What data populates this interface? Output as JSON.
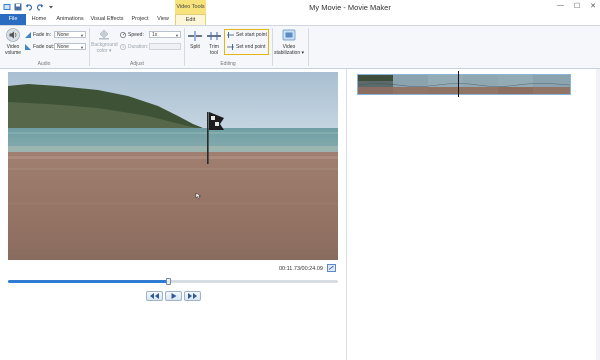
{
  "window": {
    "title": "My Movie - Movie Maker",
    "context_tab": "Video Tools",
    "controls": [
      "—",
      "☐",
      "✕"
    ]
  },
  "quick_access": {
    "icons": [
      "movie-maker-app-icon",
      "save-icon",
      "undo-icon",
      "redo-icon",
      "dropdown-icon"
    ]
  },
  "tabs": [
    "File",
    "Home",
    "Animations",
    "Visual Effects",
    "Project",
    "View",
    "Edit"
  ],
  "ribbon": {
    "audio": {
      "label": "Audio",
      "video_volume_line1": "Video",
      "video_volume_line2": "volume",
      "fade_in_label": "Fade in:",
      "fade_in_value": "None",
      "fade_out_label": "Fade out:",
      "fade_out_value": "None"
    },
    "adjust": {
      "label": "Adjust",
      "background_color_line1": "Background",
      "background_color_line2": "color ▾",
      "speed_label": "Speed:",
      "speed_value": "1x",
      "duration_label": "Duration:",
      "duration_value": ""
    },
    "editing": {
      "label": "Editing",
      "split_label": "Split",
      "trim_tool_line1": "Trim",
      "trim_tool_line2": "tool",
      "set_start_point": "Set start point",
      "set_end_point": "Set end point"
    },
    "stabilization": {
      "line1": "Video",
      "line2": "stabilization ▾"
    }
  },
  "preview": {
    "timecode": "00:11.73/00:24.09",
    "progress": 0.487
  },
  "colors": {
    "file_tab": "#2a6cc0",
    "context_tab": "#f7e27c",
    "highlight": "#e2b614",
    "seek_fill": "#2e7bd1"
  }
}
